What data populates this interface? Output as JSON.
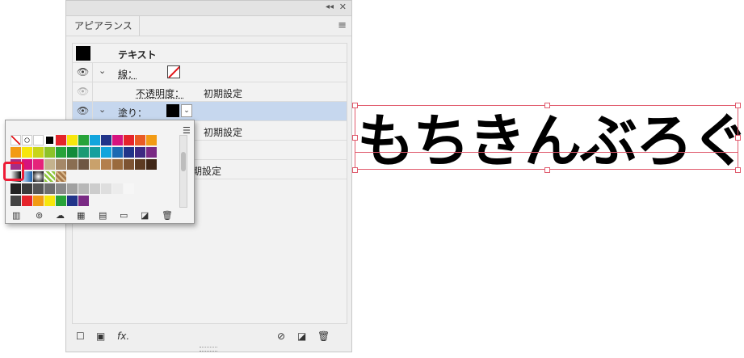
{
  "panel": {
    "tab": "アピアランス",
    "rows": {
      "object_label": "テキスト",
      "stroke_label": "線：",
      "opacity_label": "不透明度：",
      "opacity_value": "初期設定",
      "fill_label": "塗り：",
      "row5_value": "初期設定",
      "row7_value": "期設定"
    },
    "bottom_fx": "fx."
  },
  "canvas": {
    "text": "もちきんぶろぐ"
  },
  "icons": {
    "eye": "eye-icon",
    "chevron": "chevron-down-icon",
    "menu": "hamburger-icon"
  },
  "colors": {
    "selection_row": "#c6d7ee",
    "highlight": "#ee1c36",
    "bounding_box": "#e05a6c"
  },
  "swatches": {
    "row1": [
      "none",
      "register",
      "#ffffff",
      "#000000",
      "#e5242b",
      "#f7e60b",
      "#27a339",
      "#12a5dd",
      "#213489",
      "#d6137e",
      "#e5242b",
      "#e95a24",
      "#f29b14"
    ],
    "row2": [
      "#f29b14",
      "#f7e60b",
      "#c8d519",
      "#8dc329",
      "#27a339",
      "#128b3b",
      "#1a9a73",
      "#15a09e",
      "#12a5dd",
      "#1b6ab2",
      "#213489",
      "#3e2a82",
      "#7a2a84"
    ],
    "row3": [
      "#a42d86",
      "#d6137e",
      "#e5247a",
      "#c4b28e",
      "#a58868",
      "#8a6e52",
      "#6e5642",
      "#c9a16b",
      "#b37f4e",
      "#9a6a3d",
      "#7d5332",
      "#5d3b22",
      "#402717"
    ],
    "row4": [
      "gradient-bw",
      "gradient-blue",
      "gradient-radial",
      "pattern-green",
      "pattern-brown"
    ],
    "row5": [
      "#222222",
      "#3b3b3b",
      "#555555",
      "#6e6e6e",
      "#888888",
      "#a0a0a0",
      "#b7b7b7",
      "#cccccc",
      "#dedede",
      "#ececec",
      "#f6f6f6"
    ],
    "row6": [
      "folder",
      "#e5242b",
      "#f29b14",
      "#f7e60b",
      "#27a339",
      "#213489",
      "#7a2a84"
    ]
  }
}
